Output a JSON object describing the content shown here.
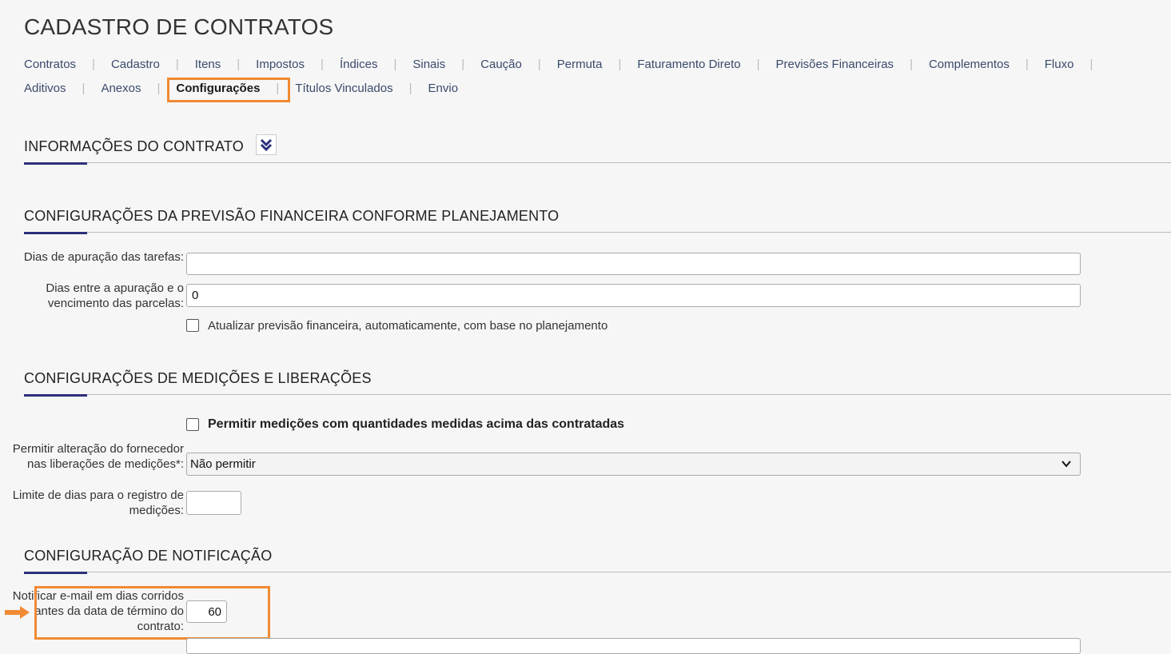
{
  "page_title": "CADASTRO DE CONTRATOS",
  "tabs_row1": [
    "Contratos",
    "Cadastro",
    "Itens",
    "Impostos",
    "Índices",
    "Sinais",
    "Caução",
    "Permuta",
    "Faturamento Direto",
    "Previsões Financeiras",
    "Complementos",
    "Fluxo"
  ],
  "tabs_row2": [
    "Aditivos",
    "Anexos",
    "Configurações",
    "Títulos Vinculados",
    "Envio"
  ],
  "active_tab": "Configurações",
  "sections": {
    "info": {
      "title": "INFORMAÇÕES DO CONTRATO"
    },
    "previsao": {
      "title": "CONFIGURAÇÕES DA PREVISÃO FINANCEIRA CONFORME PLANEJAMENTO",
      "dias_apuracao_label": "Dias de apuração das tarefas:",
      "dias_apuracao_value": "",
      "dias_entre_label": "Dias entre a apuração e o vencimento das parcelas:",
      "dias_entre_value": "0",
      "atualizar_label": "Atualizar previsão financeira, automaticamente, com base no planejamento"
    },
    "medicoes": {
      "title": "CONFIGURAÇÕES DE MEDIÇÕES E LIBERAÇÕES",
      "permitir_acima_label": "Permitir medições com quantidades medidas acima das contratadas",
      "alteracao_label": "Permitir alteração do fornecedor nas liberações de medições*:",
      "alteracao_value": "Não permitir",
      "limite_label": "Limite de dias para o registro de medições:",
      "limite_value": ""
    },
    "notificacao": {
      "title": "CONFIGURAÇÃO DE NOTIFICAÇÃO",
      "notificar_label": "Notificar e-mail em dias corridos antes da data de término do contrato:",
      "notificar_value": "60"
    }
  },
  "colors": {
    "accent": "#2c2f7a",
    "highlight": "#f08a33",
    "link": "#3a4a6b"
  }
}
